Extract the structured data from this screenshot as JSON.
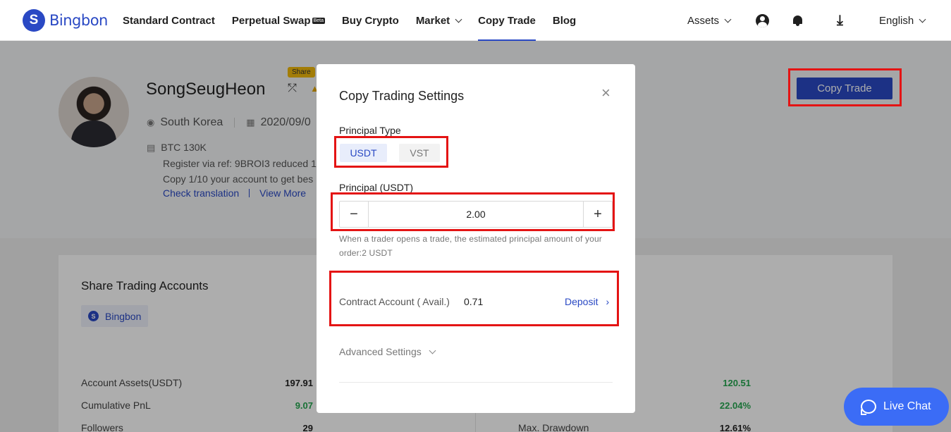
{
  "header": {
    "logo_text": "Bingbon",
    "logo_glyph": "S",
    "nav": [
      {
        "label": "Standard Contract"
      },
      {
        "label": "Perpetual Swap",
        "badge": "Beta"
      },
      {
        "label": "Buy Crypto"
      },
      {
        "label": "Market"
      },
      {
        "label": "Copy Trade"
      },
      {
        "label": "Blog"
      }
    ],
    "assets_label": "Assets",
    "language_label": "English",
    "download_glyph": "⤓"
  },
  "profile": {
    "name": "SongSeugHeon",
    "share_tag": "Share",
    "location": "South Korea",
    "date": "2020/09/0",
    "bio": [
      "BTC 130K",
      "Register via ref: 9BROI3 reduced 1",
      "Copy 1/10 your account to get bes"
    ],
    "check_translation": "Check translation",
    "view_more": "View More",
    "copy_trade_button": "Copy Trade"
  },
  "accounts": {
    "title": "Share Trading Accounts",
    "exchange_badge": "Bingbon",
    "stats_left": [
      {
        "label": "Account Assets(USDT)",
        "value": "197.91"
      },
      {
        "label": "Cumulative PnL",
        "value": "9.07"
      },
      {
        "label": "Followers",
        "value": "29"
      }
    ],
    "stats_right": [
      {
        "label": "",
        "value": "120.51"
      },
      {
        "label": "",
        "value": "22.04%"
      },
      {
        "label": "Max. Drawdown",
        "value": "12.61%"
      }
    ]
  },
  "modal": {
    "title": "Copy Trading Settings",
    "close_glyph": "×",
    "principal_type_label": "Principal Type",
    "types": [
      {
        "label": "USDT",
        "selected": true
      },
      {
        "label": "VST",
        "selected": false
      }
    ],
    "principal_label": "Principal (USDT)",
    "principal_value": "2.00",
    "minus_glyph": "−",
    "plus_glyph": "+",
    "hint": "When a trader opens a trade, the estimated principal amount of your order:2 USDT",
    "account_label": "Contract Account ( Avail.)",
    "account_value": "0.71",
    "deposit_label": "Deposit",
    "deposit_arrow": "›",
    "advanced_label": "Advanced Settings"
  },
  "live_chat": {
    "label": "Live Chat"
  },
  "colors": {
    "brand": "#2a49c4",
    "annotation": "#e41414",
    "green": "#25a750",
    "chat": "#3b6cf6"
  }
}
